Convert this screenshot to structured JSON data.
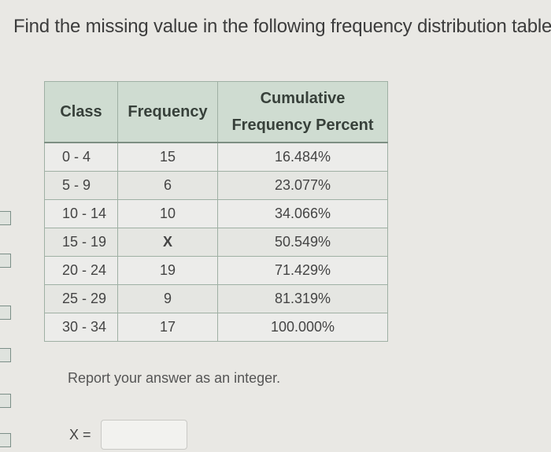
{
  "question": {
    "text": "Find the missing value in the following frequency distribution table."
  },
  "table": {
    "headers": {
      "class": "Class",
      "frequency": "Frequency",
      "cumulative_line1": "Cumulative",
      "cumulative_line2": "Frequency Percent"
    },
    "rows": [
      {
        "class": "0 - 4",
        "frequency": "15",
        "cumulative": "16.484%"
      },
      {
        "class": "5 - 9",
        "frequency": "6",
        "cumulative": "23.077%"
      },
      {
        "class": "10 - 14",
        "frequency": "10",
        "cumulative": "34.066%"
      },
      {
        "class": "15 - 19",
        "frequency": "X",
        "cumulative": "50.549%"
      },
      {
        "class": "20 - 24",
        "frequency": "19",
        "cumulative": "71.429%"
      },
      {
        "class": "25 - 29",
        "frequency": "9",
        "cumulative": "81.319%"
      },
      {
        "class": "30 - 34",
        "frequency": "17",
        "cumulative": "100.000%"
      }
    ]
  },
  "instruction": {
    "text": "Report your answer as an integer."
  },
  "answer": {
    "label": "X =",
    "value": ""
  }
}
